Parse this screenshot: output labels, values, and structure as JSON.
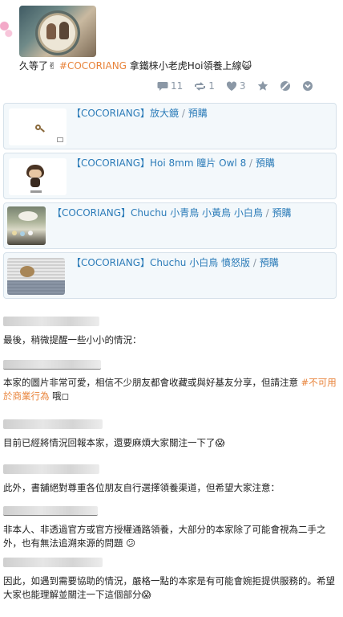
{
  "post": {
    "text_prefix": "久等了",
    "emoji_hand": "✌",
    "hashtag": "#COCORIANG",
    "text_suffix": " 拿鐵梾小老虎Hoi領養上線",
    "emoji_end": "😺"
  },
  "actions": {
    "comments_count": "11",
    "shares_count": "1",
    "likes_count": "3"
  },
  "products": [
    {
      "brand": "【COCORIANG】",
      "name": "放大鏡",
      "sep": " / ",
      "status": "預購"
    },
    {
      "brand": "【COCORIANG】",
      "name": "Hoi 8mm 瞳片 Owl 8",
      "sep": " / ",
      "status": "預購"
    },
    {
      "brand": "【COCORIANG】",
      "name": "Chuchu 小青鳥 小黃鳥 小白鳥",
      "sep": " / ",
      "status": "預購"
    },
    {
      "brand": "【COCORIANG】",
      "name": "Chuchu 小白鳥 憤怒版",
      "sep": " / ",
      "status": "預購"
    }
  ],
  "comments": [
    {
      "text": "最後，稍微提醒一些小小的情況："
    },
    {
      "text_a": "本家的圖片非常可愛，相信不少朋友都會收藏或與好基友分享，但請注意 ",
      "tag": "#不可用於商業行為",
      "text_b": " 哦◻"
    },
    {
      "text": "目前已經將情況回報本家，還要麻煩大家關注一下了😱"
    },
    {
      "text": "此外，書舖絕對尊重各位朋友自行選擇領養渠道，但希望大家注意："
    },
    {
      "text": "非本人、非透過官方或官方授權通路領養，大部分的本家除了可能會視為二手之外，也有無法追溯來源的問題 😕"
    },
    {
      "text": "因此，如遇到需要協助的情況，嚴格一點的本家是有可能會婉拒提供服務的。希望大家也能理解並關注一下這個部分😱"
    }
  ]
}
